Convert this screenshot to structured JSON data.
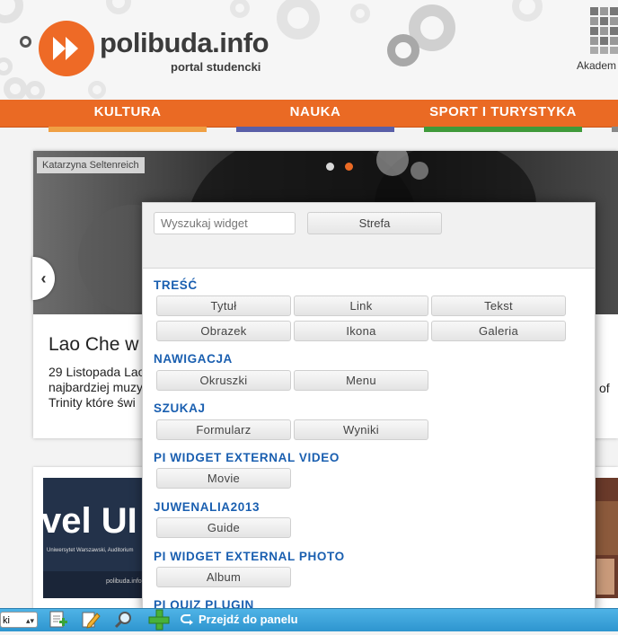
{
  "header": {
    "logo_text": "polibuda.info",
    "logo_subtitle": "portal studencki",
    "akadem_label": "Akadem"
  },
  "nav": {
    "items": [
      {
        "label": "KULTURA",
        "color": "#f0a044"
      },
      {
        "label": "NAUKA",
        "color": "#5a5fa8"
      },
      {
        "label": "SPORT I TURYSTYKA",
        "color": "#3f9a3a"
      }
    ]
  },
  "slider": {
    "photo_credit": "Katarzyna Seltenreich",
    "title": "Lao Che w",
    "text_lines": [
      "29 Listopada Lao",
      "najbardziej muzy",
      "Trinity które świ"
    ],
    "text_right": "of",
    "active_dot_color": "#ea6a24"
  },
  "cards": {
    "left_image_text": "vel UI",
    "left_image_caption": "Uniwersytet Warszawski, Auditorium",
    "left_image_brand": "polibuda.info"
  },
  "widget_panel": {
    "search_placeholder": "Wyszukaj widget",
    "strefa_label": "Strefa",
    "sections": [
      {
        "title": "TREŚĆ",
        "buttons": [
          "Tytuł",
          "Link",
          "Tekst",
          "Obrazek",
          "Ikona",
          "Galeria"
        ]
      },
      {
        "title": "NAWIGACJA",
        "buttons": [
          "Okruszki",
          "Menu"
        ]
      },
      {
        "title": "SZUKAJ",
        "buttons": [
          "Formularz",
          "Wyniki"
        ]
      },
      {
        "title": "PI WIDGET EXTERNAL VIDEO",
        "buttons": [
          "Movie"
        ]
      },
      {
        "title": "JUWENALIA2013",
        "buttons": [
          "Guide"
        ]
      },
      {
        "title": "PI WIDGET EXTERNAL PHOTO",
        "buttons": [
          "Album"
        ]
      },
      {
        "title": "PI QUIZ PLUGIN",
        "buttons": []
      }
    ]
  },
  "toolbar": {
    "select_value": "ki",
    "panel_link": "Przejdź do panelu",
    "icons": [
      "add-page-icon",
      "edit-pencil-icon",
      "magnifier-icon",
      "add-widget-plus-icon",
      "return-arrow-icon"
    ]
  }
}
